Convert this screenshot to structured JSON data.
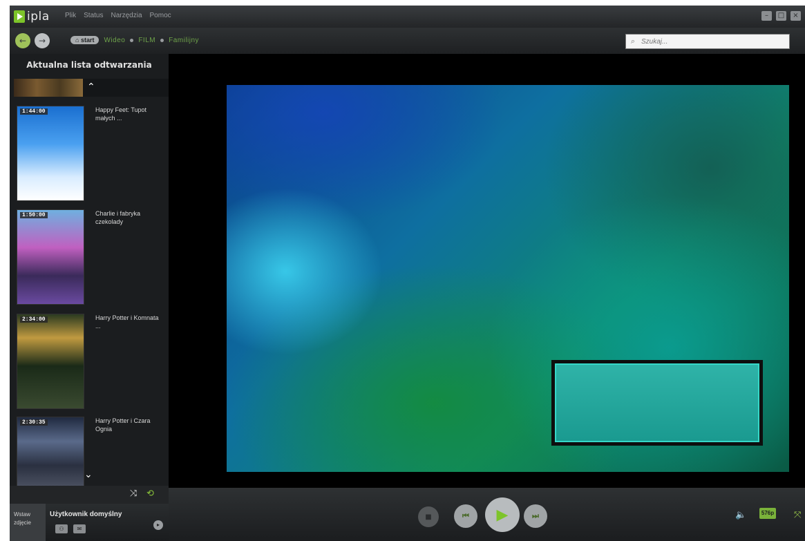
{
  "app": {
    "logo_text": "ipla"
  },
  "menu": [
    "Plik",
    "Status",
    "Narzędzia",
    "Pomoc"
  ],
  "window_controls": [
    "minimize",
    "maximize",
    "close"
  ],
  "nav": {
    "start_label": "start",
    "breadcrumbs": [
      "Wideo",
      "FILM",
      "Familijny"
    ]
  },
  "search": {
    "placeholder": "Szukaj..."
  },
  "sidebar": {
    "title": "Aktualna lista odtwarzania",
    "items": [
      {
        "duration": "1:44:00",
        "title": "Happy Feet: Tupot małych ..."
      },
      {
        "duration": "1:50:00",
        "title": "Charlie i fabryka czekolady"
      },
      {
        "duration": "2:34:00",
        "title": "Harry Potter i Komnata ..."
      },
      {
        "duration": "2:30:35",
        "title": "Harry Potter i Czara Ognia"
      }
    ]
  },
  "user": {
    "photo_label_line1": "Wstaw",
    "photo_label_line2": "zdjęcie",
    "name": "Użytkownik domyślny"
  },
  "player": {
    "quality_badge": "576p",
    "accent_color": "#7dc42a"
  }
}
